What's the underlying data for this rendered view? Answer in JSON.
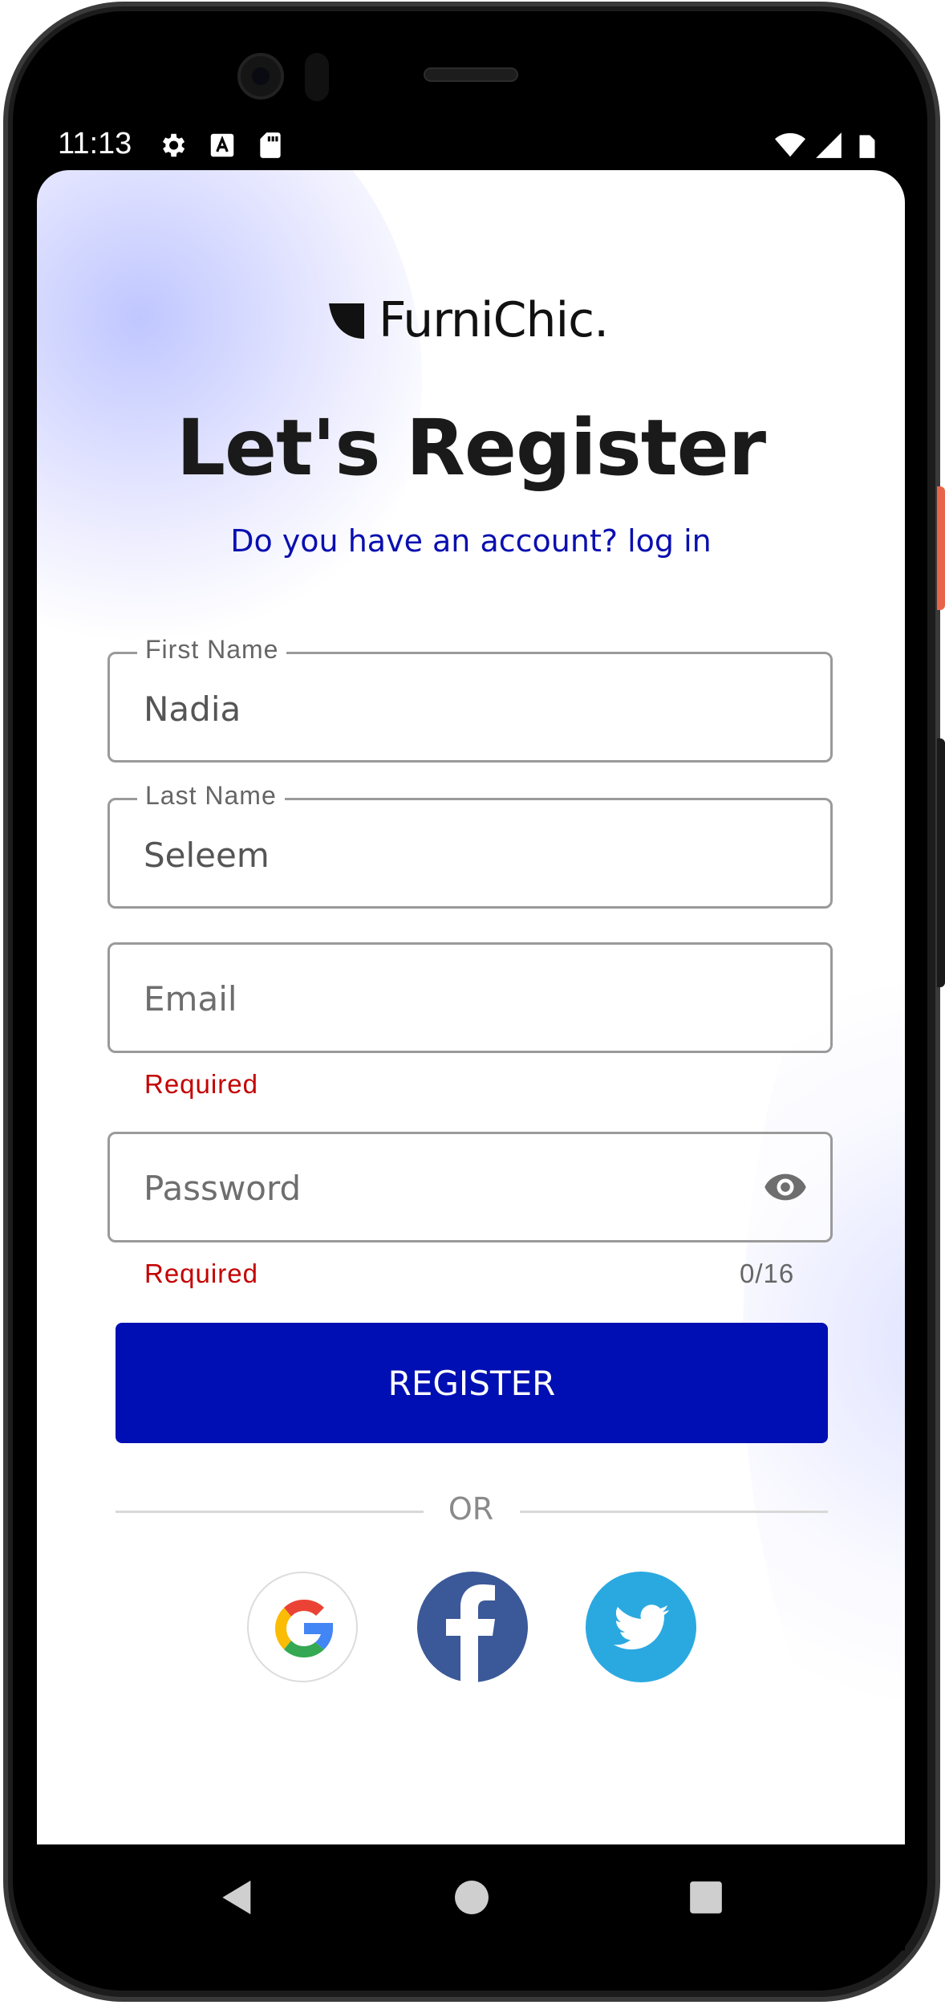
{
  "status_bar": {
    "time": "11:13",
    "icons": [
      "gear-icon",
      "a-box-icon",
      "sd-card-icon",
      "wifi-icon",
      "signal-icon",
      "battery-icon"
    ]
  },
  "app": {
    "brand": "FurniChic.",
    "title": "Let's Register",
    "subtitle": "Do you have an account? log in"
  },
  "form": {
    "first_name": {
      "label": "First Name",
      "value": "Nadia"
    },
    "last_name": {
      "label": "Last Name",
      "value": "Seleem"
    },
    "email": {
      "placeholder": "Email",
      "error": "Required"
    },
    "password": {
      "placeholder": "Password",
      "error": "Required",
      "counter": "0/16",
      "toggle_icon": "eye-icon"
    },
    "submit_label": "REGISTER"
  },
  "divider": {
    "label": "OR"
  },
  "social": [
    {
      "name": "google",
      "icon": "google-icon"
    },
    {
      "name": "facebook",
      "icon": "facebook-icon"
    },
    {
      "name": "twitter",
      "icon": "twitter-icon"
    }
  ],
  "colors": {
    "primary": "#000fb3",
    "link": "#0a0fb0",
    "error": "#c40000",
    "facebook": "#3b5998",
    "twitter": "#2aa9e0"
  },
  "nav_bar": {
    "icons": [
      "back-icon",
      "home-icon",
      "recents-icon"
    ]
  }
}
